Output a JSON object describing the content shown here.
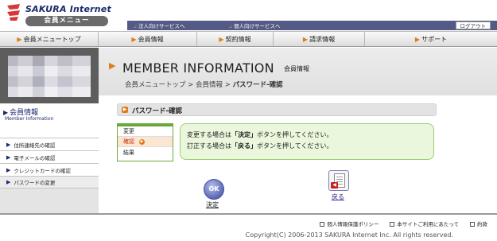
{
  "logo": {
    "brand": "SAKURA Internet",
    "badge": "会員メニュー",
    "colors": {
      "mark": "#d6383a",
      "text": "#1a2a6c"
    }
  },
  "topbar": {
    "corporate_link": "法人向けサービスへ",
    "personal_link": "個人向けサービスへ",
    "logout": "ログアウト"
  },
  "nav": {
    "items": [
      "会員メニュートップ",
      "会員情報",
      "契約情報",
      "請求情報",
      "サポート"
    ]
  },
  "sidebar": {
    "title": "会員情報",
    "subtitle": "Member Information",
    "items": [
      "住所連絡先の確認",
      "電子メールの確認",
      "クレジットカードの確認",
      "パスワードの変更"
    ],
    "active_index": 3
  },
  "header": {
    "title": "MEMBER INFORMATION",
    "title_sub": "会員情報",
    "breadcrumb": [
      "会員メニュートップ",
      "会員情報",
      "パスワード-確認"
    ],
    "separator": ">"
  },
  "section": {
    "title": "パスワード-確認"
  },
  "steps": {
    "items": [
      "変更",
      "確認",
      "結果"
    ],
    "current_index": 1
  },
  "message": {
    "line1": {
      "prefix": "変更する場合は",
      "button": "「決定」",
      "suffix": "ボタンを押してください。"
    },
    "line2": {
      "prefix": "訂正する場合は",
      "button": "「戻る」",
      "suffix": "ボタンを押してください。"
    }
  },
  "actions": {
    "ok_icon_text": "OK",
    "ok_label": "決定",
    "back_label": "戻る"
  },
  "footer": {
    "links": [
      "個人情報保護ポリシー",
      "本サイトご利用にあたって",
      "約款"
    ],
    "copyright": "Copyright(C) 2006-2013 SAKURA Internet Inc. All rights reserved."
  }
}
